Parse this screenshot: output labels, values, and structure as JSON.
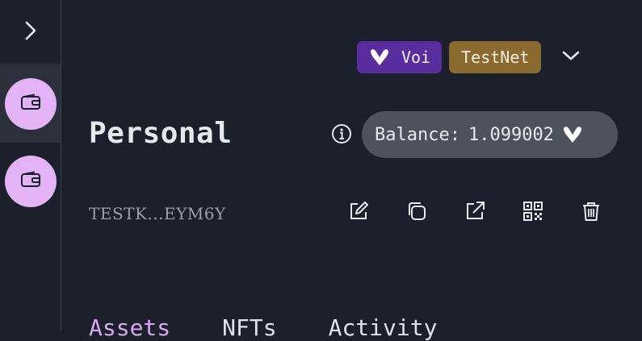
{
  "sidebar": {
    "toggle_icon": "chevron-right-icon",
    "accounts": [
      {
        "icon": "wallet-icon",
        "active": true
      },
      {
        "icon": "wallet-icon",
        "active": false
      }
    ]
  },
  "network": {
    "chain_label": "Voi",
    "chain_icon": "voi-logo-icon",
    "network_label": "TestNet",
    "dropdown_icon": "chevron-down-icon",
    "colors": {
      "chain_chip": "#5a2d9f",
      "network_chip": "#8a6a2f"
    }
  },
  "account": {
    "name": "Personal",
    "address": "TESTK...EYM6Y",
    "balance_label": "Balance:",
    "balance_value": "1.099002",
    "balance_unit_icon": "voi-logo-icon"
  },
  "actions": [
    {
      "name": "edit-icon"
    },
    {
      "name": "copy-icon"
    },
    {
      "name": "external-link-icon"
    },
    {
      "name": "qr-code-icon"
    },
    {
      "name": "trash-icon"
    }
  ],
  "tabs": [
    {
      "label": "Assets",
      "active": true
    },
    {
      "label": "NFTs",
      "active": false
    },
    {
      "label": "Activity",
      "active": false
    }
  ],
  "colors": {
    "background": "#1b202b",
    "avatar": "#e3b4f5",
    "accent": "#d9a6f0"
  }
}
